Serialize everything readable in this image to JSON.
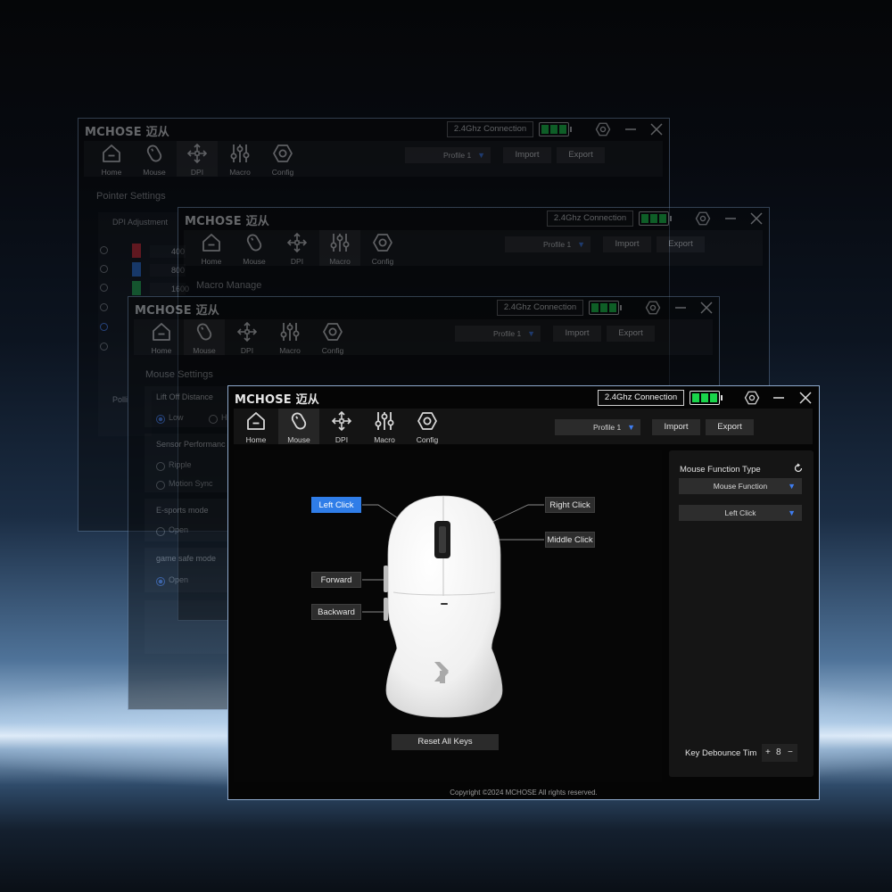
{
  "app": {
    "brand": "MCHOSE 迈从",
    "connection": "2.4Ghz Connection"
  },
  "nav": [
    {
      "label": "Home",
      "icon": "home-icon"
    },
    {
      "label": "Mouse",
      "icon": "mouse-icon"
    },
    {
      "label": "DPI",
      "icon": "move-arrows-icon"
    },
    {
      "label": "Macro",
      "icon": "sliders-icon"
    },
    {
      "label": "Config",
      "icon": "hexagon-icon"
    }
  ],
  "header": {
    "profile": "Profile  1",
    "import": "Import",
    "export": "Export"
  },
  "win1": {
    "section": "Pointer Settings",
    "dpi_title": "DPI Adjustment",
    "dpi_levels": [
      {
        "value": "400",
        "color": "#d8262b"
      },
      {
        "value": "800",
        "color": "#2b6fd6"
      },
      {
        "value": "1600",
        "color": "#22b24a"
      }
    ],
    "polling": "Polli"
  },
  "win2": {
    "section": "Macro Manage"
  },
  "win3": {
    "section": "Mouse Settings",
    "lift_off": "Lift Off Distance",
    "lift_opt_low": "Low",
    "lift_opt_h": "H",
    "sensor": "Sensor Performanc",
    "ripple": "Ripple",
    "motion_sync": "Motion Sync",
    "esports": "E-sports mode",
    "esports_opt": "Open",
    "gamesafe": "game safe mode",
    "gamesafe_opt": "Open"
  },
  "main": {
    "buttons": {
      "left": "Left Click",
      "right": "Right Click",
      "middle": "Middle Click",
      "forward": "Forward",
      "backward": "Backward"
    },
    "reset": "Reset All Keys",
    "panel": {
      "title": "Mouse Function Type",
      "type_select": "Mouse Function",
      "func_select": "Left Click"
    },
    "debounce_label": "Key Debounce Tim",
    "debounce_plus": "+",
    "debounce_value": "8",
    "debounce_minus": "−",
    "copyright": "Copyright ©2024 MCHOSE All rights reserved."
  },
  "colors": {
    "accent": "#2f7de8",
    "battery": "#19d44a"
  }
}
